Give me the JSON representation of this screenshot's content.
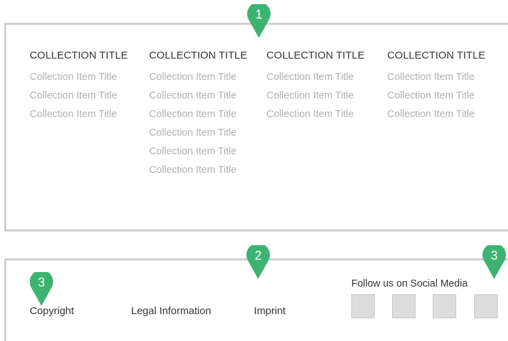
{
  "collections": [
    {
      "title": "COLLECTION TITLE",
      "items": [
        "Collection Item Title",
        "Collection Item Title",
        "Collection Item Title"
      ]
    },
    {
      "title": "COLLECTION TITLE",
      "items": [
        "Collection Item Title",
        "Collection Item Title",
        "Collection Item Title",
        "Collection Item Title",
        "Collection Item Title",
        "Collection Item Title"
      ]
    },
    {
      "title": "COLLECTION TITLE",
      "items": [
        "Collection Item Title",
        "Collection Item Title",
        "Collection Item Title"
      ]
    },
    {
      "title": "COLLECTION TITLE",
      "items": [
        "Collection Item Title",
        "Collection Item Title",
        "Collection Item Title"
      ]
    }
  ],
  "footer": {
    "copyright": "Copyright",
    "legal": "Legal Information",
    "imprint": "Imprint",
    "social_heading": "Follow us on Social Media"
  },
  "markers": {
    "m1": "1",
    "m2": "2",
    "m3_left": "3",
    "m3_right": "3"
  },
  "colors": {
    "marker_green": "#3cb371",
    "panel_border": "#cfcfcf",
    "item_text": "#b0b0b0",
    "social_box": "#dddddd"
  }
}
